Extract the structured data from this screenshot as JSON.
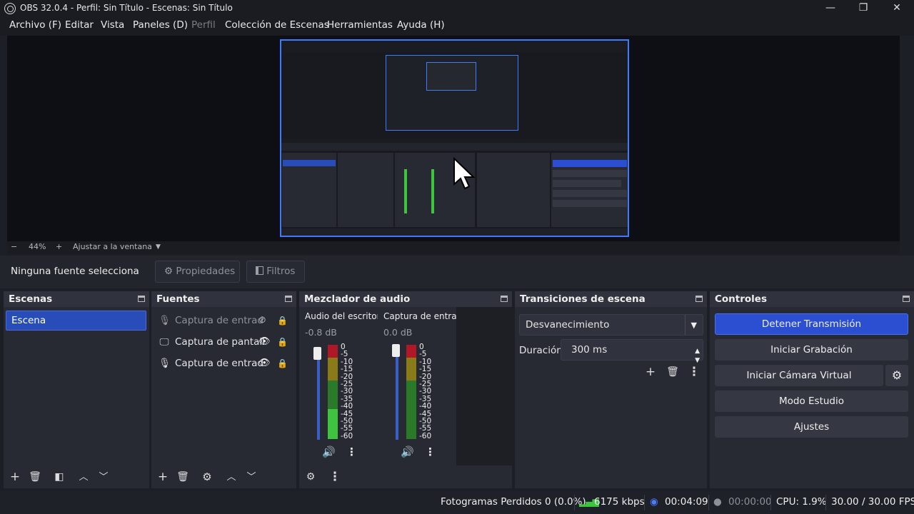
{
  "window": {
    "title": "OBS 32.0.4 - Perfil: Sin Título - Escenas: Sin Título",
    "minimize": "—",
    "maximize": "❐",
    "close": "✕"
  },
  "menu": [
    "Archivo (F)",
    "Editar",
    "Vista",
    "Paneles (D)",
    "Perfil",
    "Colección de Escenas",
    "Herramientas",
    "Ayuda (H)"
  ],
  "zoom": {
    "minus": "−",
    "value": "44%",
    "plus": "+",
    "fit": "Ajustar a la ventana",
    "dropdown": "▼"
  },
  "source_toolbar": {
    "no_source": "Ninguna fuente selecciona",
    "properties": "Propiedades",
    "filters": "Filtros"
  },
  "scenes": {
    "title": "Escenas",
    "items": [
      "Escena"
    ]
  },
  "sources": {
    "title": "Fuentes",
    "items": [
      {
        "icon": "microphone-icon",
        "label": "Captura de entrad",
        "visible": false
      },
      {
        "icon": "monitor-icon",
        "label": "Captura de pantall",
        "visible": true
      },
      {
        "icon": "microphone-icon",
        "label": "Captura de entrad",
        "visible": true
      }
    ]
  },
  "mixer": {
    "title": "Mezclador de audio",
    "channels": [
      {
        "name": "Audio del escritorio",
        "db": "-0.8 dB"
      },
      {
        "name": "Captura de entrada",
        "db": "0.0 dB"
      }
    ],
    "scale": [
      "0",
      "-5",
      "-10",
      "-15",
      "-20",
      "-25",
      "-30",
      "-35",
      "-40",
      "-45",
      "-50",
      "-55",
      "-60"
    ]
  },
  "transitions": {
    "title": "Transiciones de escena",
    "selected": "Desvanecimiento",
    "duration_label": "Duración",
    "duration_value": "300 ms"
  },
  "controls": {
    "title": "Controles",
    "stop_stream": "Detener Transmisión",
    "start_recording": "Iniciar Grabación",
    "virtual_camera": "Iniciar Cámara Virtual",
    "studio_mode": "Modo Estudio",
    "settings": "Ajustes"
  },
  "status": {
    "dropped": "Fotogramas Perdidos 0 (0.0%)",
    "bitrate": "6175 kbps",
    "stream_time": "00:04:09",
    "record_time": "00:00:00",
    "cpu": "CPU: 1.9%",
    "fps": "30.00 / 30.00 FPS"
  },
  "colors": {
    "accent": "#2c4fd1",
    "selection": "#284cb8",
    "preview_border": "#3e7bff",
    "meter_green": "#3ec43e",
    "meter_yellow": "#c9c020",
    "meter_red": "#b01828"
  }
}
